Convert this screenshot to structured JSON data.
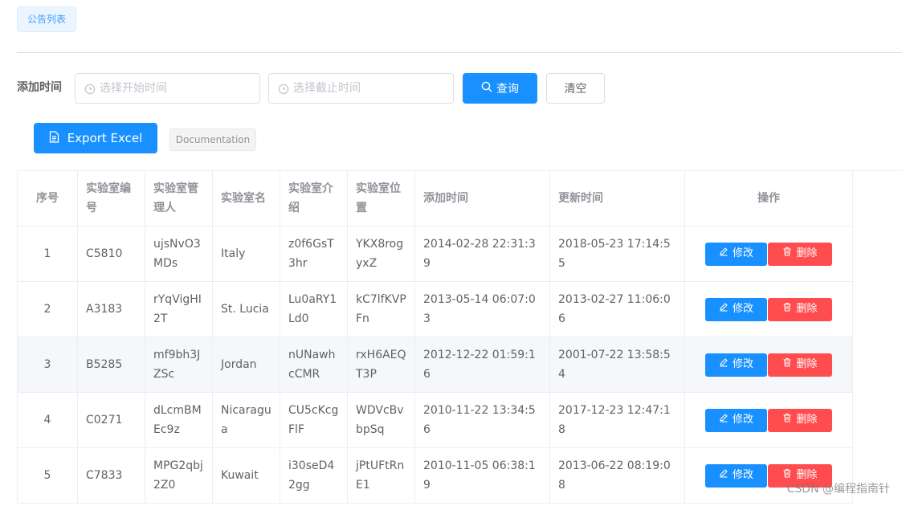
{
  "header": {
    "tag_label": "公告列表"
  },
  "filters": {
    "label": "添加时间",
    "start_placeholder": "选择开始时间",
    "end_placeholder": "选择截止时间",
    "query_label": "查询",
    "clear_label": "清空"
  },
  "toolbar": {
    "export_label": "Export Excel",
    "doc_label": "Documentation"
  },
  "table": {
    "headers": [
      "序号",
      "实验室编号",
      "实验室管理人",
      "实验室名",
      "实验室介绍",
      "实验室位置",
      "添加时间",
      "更新时间",
      "操作"
    ],
    "rows": [
      {
        "index": "1",
        "code": "C5810",
        "manager": "ujsNvO3MDs",
        "name": "Italy",
        "intro": "z0f6GsT3hr",
        "location": "YKX8rogyxZ",
        "added": "2014-02-28 22:31:39",
        "updated": "2018-05-23 17:14:55"
      },
      {
        "index": "2",
        "code": "A3183",
        "manager": "rYqVigHI2T",
        "name": "St. Lucia",
        "intro": "Lu0aRY1Ld0",
        "location": "kC7lfKVPFn",
        "added": "2013-05-14 06:07:03",
        "updated": "2013-02-27 11:06:06"
      },
      {
        "index": "3",
        "code": "B5285",
        "manager": "mf9bh3JZSc",
        "name": "Jordan",
        "intro": "nUNawhcCMR",
        "location": "rxH6AEQT3P",
        "added": "2012-12-22 01:59:16",
        "updated": "2001-07-22 13:58:54"
      },
      {
        "index": "4",
        "code": "C0271",
        "manager": "dLcmBMEc9z",
        "name": "Nicaragua",
        "intro": "CU5cKcgFlF",
        "location": "WDVcBvbpSq",
        "added": "2010-11-22 13:34:56",
        "updated": "2017-12-23 12:47:18"
      },
      {
        "index": "5",
        "code": "C7833",
        "manager": "MPG2qbj2Z0",
        "name": "Kuwait",
        "intro": "i30seD42gg",
        "location": "jPtUFtRnE1",
        "added": "2010-11-05 06:38:19",
        "updated": "2013-06-22 08:19:08"
      }
    ],
    "edit_label": "修改",
    "delete_label": "删除"
  },
  "watermark": "CSDN @编程指南针",
  "colors": {
    "primary": "#1890ff",
    "danger": "#ff4d4f",
    "stripe": "#f5f7fa"
  }
}
